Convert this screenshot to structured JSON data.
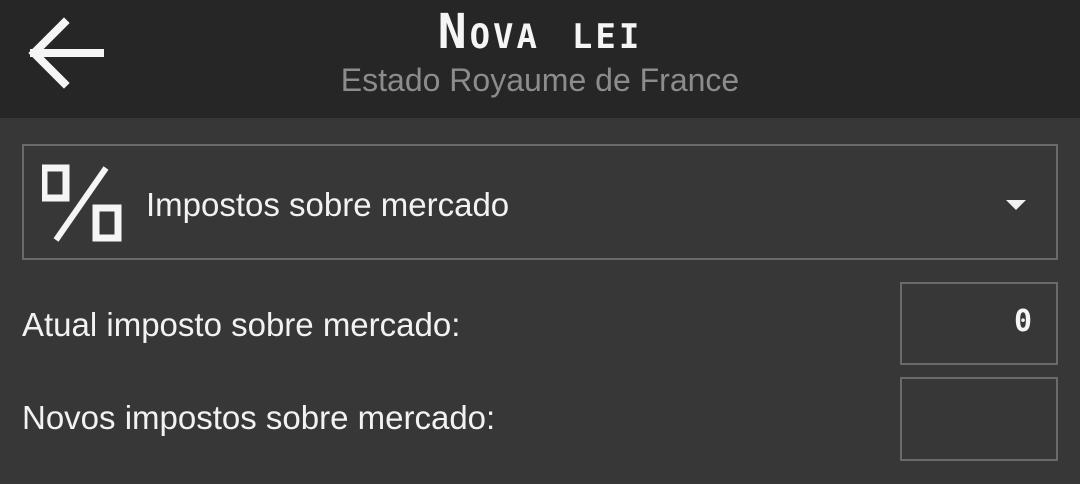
{
  "header": {
    "title": "Nova lei",
    "subtitle": "Estado Royaume de France",
    "back_icon": "arrow-left-icon"
  },
  "law_selector": {
    "icon": "percent-icon",
    "selected": "Impostos sobre mercado",
    "caret_icon": "caret-down-icon"
  },
  "current_tax": {
    "label": "Atual imposto sobre mercado:",
    "value": "0"
  },
  "new_tax": {
    "label": "Novos impostos sobre mercado:",
    "value": ""
  },
  "colors": {
    "background": "#373737",
    "header": "#262626",
    "border": "#6a6a6a",
    "subtitle": "#8c8c8c"
  }
}
